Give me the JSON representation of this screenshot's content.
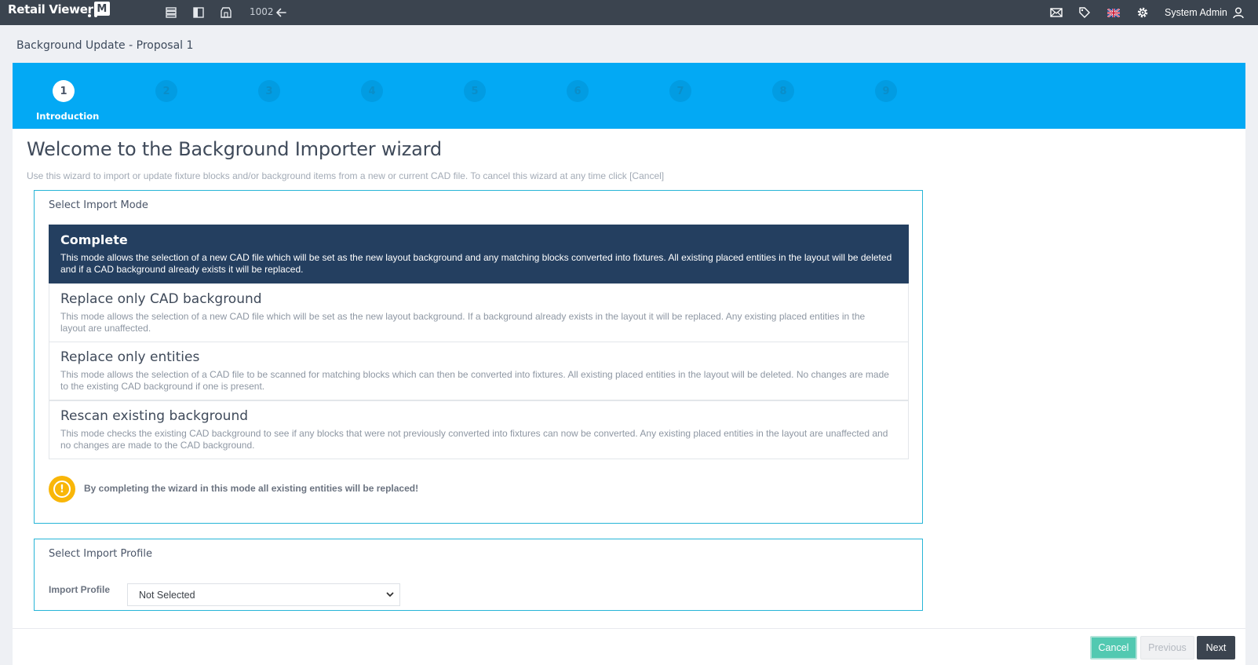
{
  "app": {
    "logo_text": "Retail Viewer",
    "logo_mark": "M",
    "layout_id": "1002",
    "user_name": "System Admin"
  },
  "icons": {
    "toolbar": [
      "layers-icon",
      "panel-icon",
      "store-icon",
      "back-arrow-icon"
    ],
    "right": [
      "mail-icon",
      "tag-icon",
      "uk-flag-icon",
      "gear-icon",
      "user-icon"
    ]
  },
  "page": {
    "title": "Background Update - Proposal 1"
  },
  "wizard": {
    "steps": [
      "1",
      "2",
      "3",
      "4",
      "5",
      "6",
      "7",
      "8",
      "9"
    ],
    "active_step": 1,
    "active_step_label": "Introduction",
    "title": "Welcome to the Background Importer wizard",
    "subtitle": "Use this wizard to import or update fixture blocks and/or background items from a new or current CAD file. To cancel this wizard at any time click [Cancel]"
  },
  "import_mode": {
    "heading": "Select Import Mode",
    "selected_index": 0,
    "options": [
      {
        "title": "Complete",
        "desc": "This mode allows the selection of a new CAD file which will be set as the new layout background and any matching blocks converted into fixtures. All existing placed entities in the layout will be deleted and if a CAD background already exists it will be replaced."
      },
      {
        "title": "Replace only CAD background",
        "desc": "This mode allows the selection of a new CAD file which will be set as the new layout background. If a background already exists in the layout it will be replaced. Any existing placed entities in the layout are unaffected."
      },
      {
        "title": "Replace only entities",
        "desc": "This mode allows the selection of a CAD file to be scanned for matching blocks which can then be converted into fixtures. All existing placed entities in the layout will be deleted. No changes are made to the existing CAD background if one is present."
      },
      {
        "title": "Rescan existing background",
        "desc": "This mode checks the existing CAD background to see if any blocks that were not previously converted into fixtures can now be converted. Any existing placed entities in the layout are unaffected and no changes are made to the CAD background."
      }
    ],
    "warning": "By completing the wizard in this mode all existing entities will be replaced!"
  },
  "import_profile": {
    "heading": "Select Import Profile",
    "label": "Import Profile",
    "value": "Not Selected"
  },
  "buttons": {
    "cancel": "Cancel",
    "previous": "Previous",
    "next": "Next"
  },
  "colors": {
    "topbar": "#3b444f",
    "stepper": "#03a9f4",
    "selected_option": "#243f60",
    "panel_border": "#27b5d7",
    "warning": "#f9b608",
    "cancel_button": "#52c9b1"
  }
}
